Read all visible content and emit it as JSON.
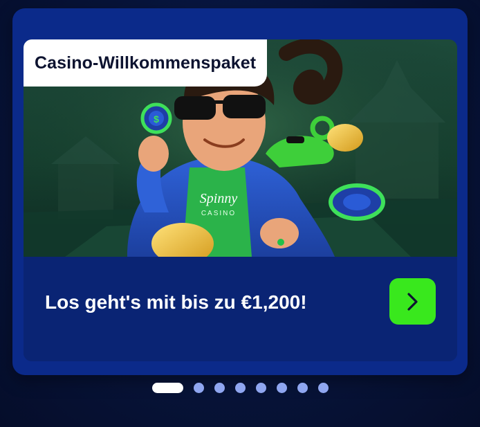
{
  "promo": {
    "badge_label": "Casino-Willkommenspaket",
    "offer_text": "Los geht's mit bis zu €1,200!",
    "cta_icon": "chevron-right-icon",
    "hero_logo_text": "Spinny",
    "hero_logo_subtext": "CASINO",
    "hero_chip_symbol": "$"
  },
  "carousel": {
    "total_slides": 8,
    "active_index": 0
  },
  "colors": {
    "page_background": "#071338",
    "card_background": "#0b2a8a",
    "panel_background": "#0a2474",
    "cta_green": "#39e81d",
    "dot_active": "#ffffff",
    "dot_inactive": "#8fa6f0"
  }
}
